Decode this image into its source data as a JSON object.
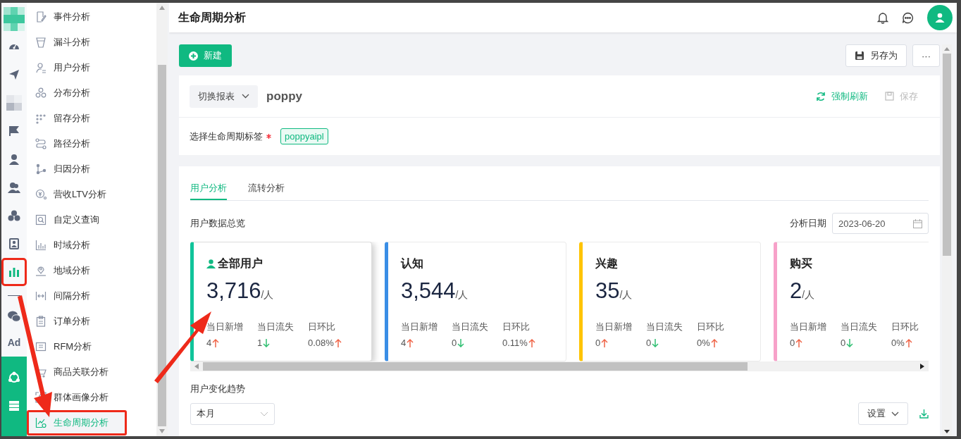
{
  "rail": {
    "top": [
      {
        "kind": "logo",
        "annotated": false
      },
      {
        "kind": "gauge",
        "annotated": false
      },
      {
        "kind": "send",
        "annotated": false
      },
      {
        "kind": "blur",
        "annotated": false
      },
      {
        "kind": "flag",
        "annotated": false
      },
      {
        "kind": "user",
        "annotated": false
      },
      {
        "kind": "users",
        "annotated": false
      },
      {
        "kind": "cluster",
        "annotated": false
      },
      {
        "kind": "badge",
        "annotated": false
      },
      {
        "kind": "chart",
        "annotated": true
      },
      {
        "kind": "divider",
        "annotated": false
      },
      {
        "kind": "chat",
        "annotated": false
      },
      {
        "kind": "text",
        "label": "Ad",
        "annotated": false
      }
    ],
    "bottom": [
      {
        "kind": "hub",
        "annotated": false
      },
      {
        "kind": "server",
        "annotated": false
      }
    ]
  },
  "menu": [
    {
      "label": "事件分析",
      "selected": false,
      "annotated": false
    },
    {
      "label": "漏斗分析",
      "selected": false,
      "annotated": false
    },
    {
      "label": "用户分析",
      "selected": false,
      "annotated": false
    },
    {
      "label": "分布分析",
      "selected": false,
      "annotated": false
    },
    {
      "label": "留存分析",
      "selected": false,
      "annotated": false
    },
    {
      "label": "路径分析",
      "selected": false,
      "annotated": false
    },
    {
      "label": "归因分析",
      "selected": false,
      "annotated": false
    },
    {
      "label": "营收LTV分析",
      "selected": false,
      "annotated": false
    },
    {
      "label": "自定义查询",
      "selected": false,
      "annotated": false
    },
    {
      "label": "时域分析",
      "selected": false,
      "annotated": false
    },
    {
      "label": "地域分析",
      "selected": false,
      "annotated": false
    },
    {
      "label": "间隔分析",
      "selected": false,
      "annotated": false
    },
    {
      "label": "订单分析",
      "selected": false,
      "annotated": false
    },
    {
      "label": "RFM分析",
      "selected": false,
      "annotated": false
    },
    {
      "label": "商品关联分析",
      "selected": false,
      "annotated": false
    },
    {
      "label": "群体画像分析",
      "selected": false,
      "annotated": false
    },
    {
      "label": "生命周期分析",
      "selected": true,
      "annotated": true
    }
  ],
  "header": {
    "title": "生命周期分析"
  },
  "toolbar": {
    "new_button": "新建",
    "save_as_button": "另存为",
    "more_button": "···"
  },
  "report": {
    "switch_button": "切换报表",
    "name": "poppy",
    "refresh_button": "强制刷新",
    "save_button": {
      "label": "保存",
      "disabled": true
    },
    "tag_label": "选择生命周期标签",
    "required": true,
    "tag": "poppyaipl"
  },
  "tabs": [
    {
      "label": "用户分析",
      "selected": true
    },
    {
      "label": "流转分析",
      "selected": false
    }
  ],
  "overview": {
    "title": "用户数据总览",
    "date_label": "分析日期",
    "date": "2023-06-20"
  },
  "cards": [
    {
      "title": "全部用户",
      "user_icon": true,
      "value": "3,716",
      "unit": "/人",
      "color": "#10c49a",
      "selected": true,
      "stats": [
        {
          "label": "当日新增",
          "value": "4",
          "rising": true
        },
        {
          "label": "当日流失",
          "value": "1",
          "rising": false
        },
        {
          "label": "日环比",
          "value": "0.08%",
          "rising": true
        }
      ]
    },
    {
      "title": "认知",
      "user_icon": false,
      "value": "3,544",
      "unit": "/人",
      "color": "#3a8ee6",
      "selected": false,
      "stats": [
        {
          "label": "当日新增",
          "value": "4",
          "rising": true
        },
        {
          "label": "当日流失",
          "value": "0",
          "rising": false
        },
        {
          "label": "日环比",
          "value": "0.11%",
          "rising": true
        }
      ]
    },
    {
      "title": "兴趣",
      "user_icon": false,
      "value": "35",
      "unit": "/人",
      "color": "#ffc400",
      "selected": false,
      "stats": [
        {
          "label": "当日新增",
          "value": "0",
          "rising": true
        },
        {
          "label": "当日流失",
          "value": "0",
          "rising": false
        },
        {
          "label": "日环比",
          "value": "0%",
          "rising": true
        }
      ]
    },
    {
      "title": "购买",
      "user_icon": false,
      "value": "2",
      "unit": "/人",
      "color": "#f7a1c9",
      "selected": false,
      "stats": [
        {
          "label": "当日新增",
          "value": "0",
          "rising": true
        },
        {
          "label": "当日流失",
          "value": "0",
          "rising": false
        },
        {
          "label": "日环比",
          "value": "0%",
          "rising": true
        }
      ]
    }
  ],
  "trend": {
    "title": "用户变化趋势",
    "period": "本月",
    "settings_button": "设置"
  }
}
